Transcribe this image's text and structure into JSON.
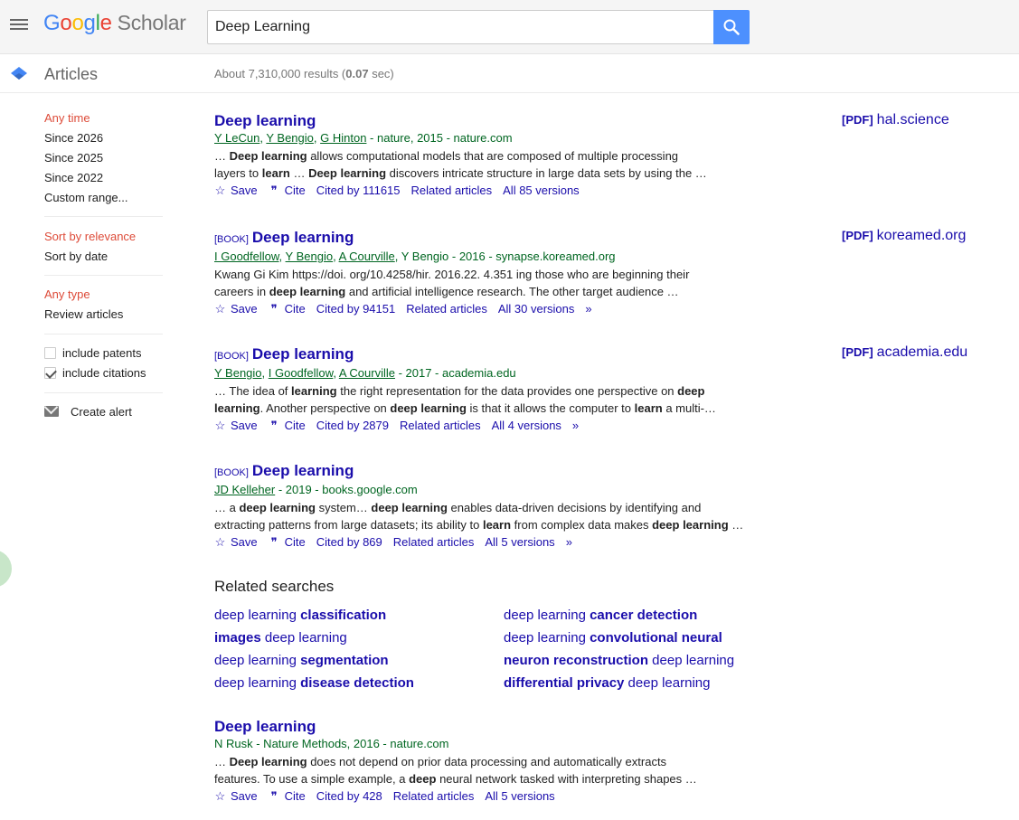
{
  "brand": {
    "google": [
      "G",
      "o",
      "o",
      "g",
      "l",
      "e"
    ],
    "scholar": "Scholar",
    "colors": [
      "#4285f4",
      "#ea4335",
      "#fbbc05",
      "#4285f4",
      "#34a853",
      "#ea4335"
    ]
  },
  "search": {
    "value": "Deep Learning"
  },
  "subbar": {
    "section": "Articles",
    "count_prefix": "About 7,310,000 results (",
    "count_time": "0.07",
    "count_suffix": " sec)"
  },
  "sidebar": {
    "time": [
      "Any time",
      "Since 2026",
      "Since 2025",
      "Since 2022",
      "Custom range..."
    ],
    "sort": [
      "Sort by relevance",
      "Sort by date"
    ],
    "type": [
      "Any type",
      "Review articles"
    ],
    "include_patents": "include patents",
    "include_citations": "include citations",
    "create_alert": "Create alert"
  },
  "results": [
    {
      "tag": "",
      "title": "Deep learning",
      "authors": [
        "Y LeCun",
        "Y Bengio",
        "G Hinton"
      ],
      "plain_author": "",
      "source": " - nature, 2015 - nature.com",
      "snippet1": [
        [
          "… ",
          false
        ],
        [
          "Deep learning",
          true
        ],
        [
          " allows computational models that are composed of multiple processing",
          false
        ]
      ],
      "snippet2": [
        [
          "layers to ",
          false
        ],
        [
          "learn",
          true
        ],
        [
          " … ",
          false
        ],
        [
          "Deep learning",
          true
        ],
        [
          " discovers intricate structure in large data sets by using the …",
          false
        ]
      ],
      "actions": {
        "save": "Save",
        "cite": "Cite",
        "cited_by": "Cited by 111615",
        "related": "Related articles",
        "versions": "All 85 versions"
      },
      "more": false,
      "pdf": {
        "tag": "[PDF]",
        "site": "hal.science"
      }
    },
    {
      "tag": "[BOOK]",
      "title": "Deep learning",
      "authors": [
        "I Goodfellow",
        "Y Bengio",
        "A Courville"
      ],
      "plain_author": "Y Bengio",
      "source": " - 2016 - synapse.koreamed.org",
      "snippet1": [
        [
          "Kwang Gi Kim https://doi. org/10.4258/hir. 2016.22. 4.351 ing those who are beginning their",
          false
        ]
      ],
      "snippet2": [
        [
          "careers in ",
          false
        ],
        [
          "deep learning",
          true
        ],
        [
          " and artificial intelligence research. The other target audience …",
          false
        ]
      ],
      "actions": {
        "save": "Save",
        "cite": "Cite",
        "cited_by": "Cited by 94151",
        "related": "Related articles",
        "versions": "All 30 versions"
      },
      "more": true,
      "pdf": {
        "tag": "[PDF]",
        "site": "koreamed.org"
      }
    },
    {
      "tag": "[BOOK]",
      "title": "Deep learning",
      "authors": [
        "Y Bengio",
        "I Goodfellow",
        "A Courville"
      ],
      "plain_author": "",
      "source": " - 2017 - academia.edu",
      "snippet1": [
        [
          "… The idea of ",
          false
        ],
        [
          "learning",
          true
        ],
        [
          " the right representation for the data provides one perspective on ",
          false
        ],
        [
          "deep",
          true
        ]
      ],
      "snippet2": [
        [
          "learning",
          true
        ],
        [
          ". Another perspective on ",
          false
        ],
        [
          "deep learning",
          true
        ],
        [
          " is that it allows the computer to ",
          false
        ],
        [
          "learn",
          true
        ],
        [
          " a multi-…",
          false
        ]
      ],
      "actions": {
        "save": "Save",
        "cite": "Cite",
        "cited_by": "Cited by 2879",
        "related": "Related articles",
        "versions": "All 4 versions"
      },
      "more": true,
      "pdf": {
        "tag": "[PDF]",
        "site": "academia.edu"
      }
    },
    {
      "tag": "[BOOK]",
      "title": "Deep learning",
      "authors": [
        "JD Kelleher"
      ],
      "plain_author": "",
      "source": " - 2019 - books.google.com",
      "snippet1": [
        [
          "… a ",
          false
        ],
        [
          "deep learning",
          true
        ],
        [
          " system… ",
          false
        ],
        [
          "deep learning",
          true
        ],
        [
          " enables data-driven decisions by identifying and",
          false
        ]
      ],
      "snippet2": [
        [
          "extracting patterns from large datasets; its ability to ",
          false
        ],
        [
          "learn",
          true
        ],
        [
          " from complex data makes ",
          false
        ],
        [
          "deep learning",
          true
        ],
        [
          " …",
          false
        ]
      ],
      "actions": {
        "save": "Save",
        "cite": "Cite",
        "cited_by": "Cited by 869",
        "related": "Related articles",
        "versions": "All 5 versions"
      },
      "more": true,
      "pdf": null
    },
    {
      "tag": "",
      "title": "Deep learning",
      "authors": [],
      "plain_author": "N Rusk",
      "source": " - Nature Methods, 2016 - nature.com",
      "snippet1": [
        [
          "… ",
          false
        ],
        [
          "Deep learning",
          true
        ],
        [
          " does not depend on prior data processing and automatically extracts",
          false
        ]
      ],
      "snippet2": [
        [
          "features. To use a simple example, a ",
          false
        ],
        [
          "deep",
          true
        ],
        [
          " neural network tasked with interpreting shapes …",
          false
        ]
      ],
      "actions": {
        "save": "Save",
        "cite": "Cite",
        "cited_by": "Cited by 428",
        "related": "Related articles",
        "versions": "All 5 versions"
      },
      "more": false,
      "pdf": null
    }
  ],
  "related_searches": {
    "title": "Related searches",
    "left": [
      [
        [
          "deep learning ",
          false
        ],
        [
          "classification",
          true
        ]
      ],
      [
        [
          "images",
          true
        ],
        [
          " deep learning",
          false
        ]
      ],
      [
        [
          "deep learning ",
          false
        ],
        [
          "segmentation",
          true
        ]
      ],
      [
        [
          "deep learning ",
          false
        ],
        [
          "disease detection",
          true
        ]
      ]
    ],
    "right": [
      [
        [
          "deep learning ",
          false
        ],
        [
          "cancer detection",
          true
        ]
      ],
      [
        [
          "deep learning ",
          false
        ],
        [
          "convolutional neural",
          true
        ]
      ],
      [
        [
          "neuron reconstruction",
          true
        ],
        [
          " deep learning",
          false
        ]
      ],
      [
        [
          "differential privacy",
          true
        ],
        [
          " deep learning",
          false
        ]
      ]
    ]
  }
}
